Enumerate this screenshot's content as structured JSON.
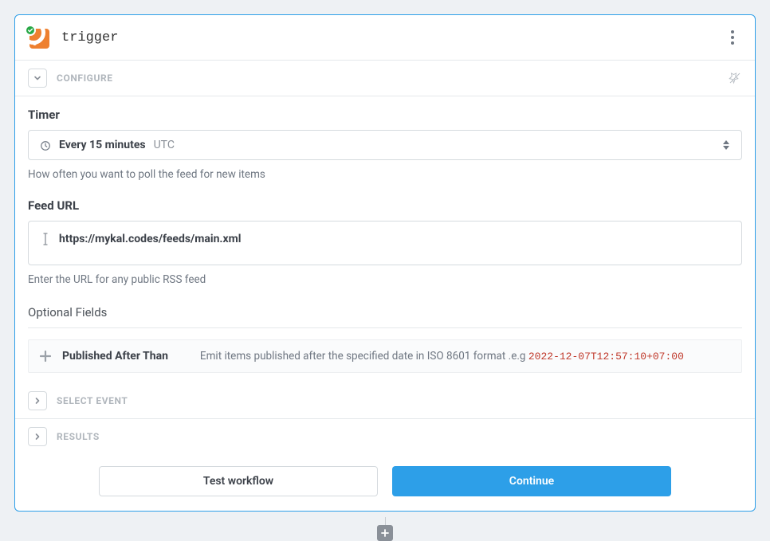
{
  "header": {
    "title": "trigger"
  },
  "sections": {
    "configure": "CONFIGURE",
    "select_event": "SELECT EVENT",
    "results": "RESULTS"
  },
  "timer": {
    "label": "Timer",
    "value": "Every 15 minutes",
    "tz": "UTC",
    "hint": "How often you want to poll the feed for new items"
  },
  "feed": {
    "label": "Feed URL",
    "value": "https://mykal.codes/feeds/main.xml",
    "hint": "Enter the URL for any public RSS feed"
  },
  "optional": {
    "header": "Optional Fields",
    "item": {
      "name": "Published After Than",
      "desc": "Emit items published after the specified date in ISO 8601 format .e.g ",
      "example": "2022-12-07T12:57:10+07:00"
    }
  },
  "footer": {
    "test": "Test workflow",
    "continue": "Continue"
  }
}
